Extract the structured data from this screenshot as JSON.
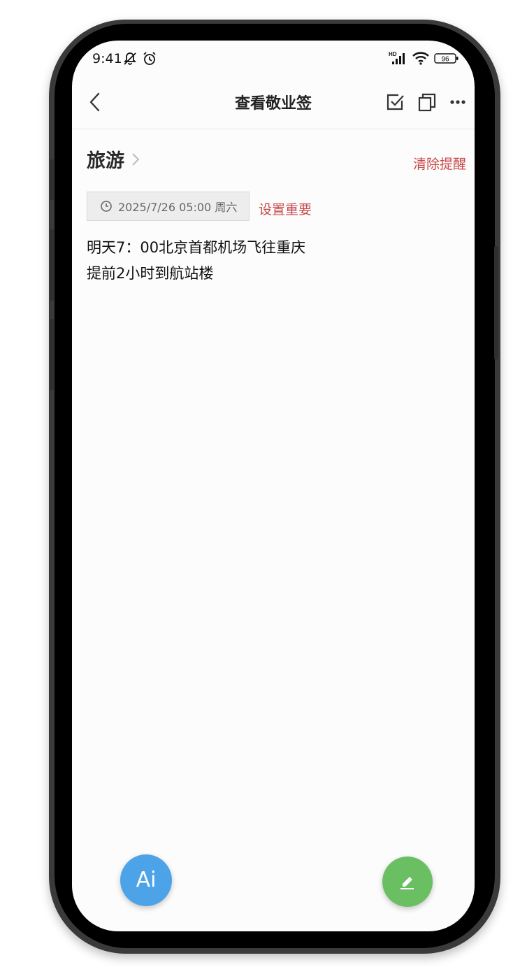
{
  "status_bar": {
    "time": "9:41",
    "network_label": "HD",
    "battery": "96"
  },
  "header": {
    "title": "查看敬业签"
  },
  "note": {
    "category": "旅游",
    "clear_reminder_label": "清除提醒",
    "reminder_datetime": "2025/7/26 05:00 周六",
    "set_important_label": "设置重要",
    "lines": [
      "明天7：00北京首都机场飞往重庆",
      "提前2小时到航站楼"
    ]
  },
  "fab": {
    "ai_label": "Ai"
  },
  "colors": {
    "accent_red": "#c8494a",
    "ai_blue": "#4da3e8",
    "edit_green": "#6bbf63"
  }
}
